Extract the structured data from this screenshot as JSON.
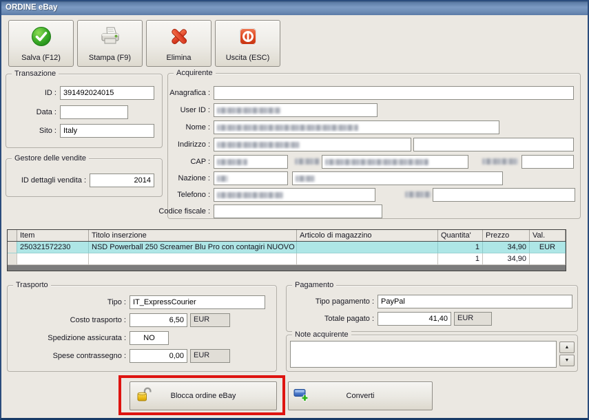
{
  "window": {
    "title": "ORDINE eBay",
    "close_glyph": "✕"
  },
  "toolbar": {
    "salva": "Salva (F12)",
    "stampa": "Stampa (F9)",
    "elimina": "Elimina",
    "uscita": "Uscita (ESC)"
  },
  "transazione": {
    "title": "Transazione",
    "id_label": "ID :",
    "id_value": "391492024015",
    "data_label": "Data :",
    "data_value": "",
    "sito_label": "Sito :",
    "sito_value": "Italy"
  },
  "gestore": {
    "title": "Gestore delle vendite",
    "id_dettagli_label": "ID dettagli vendita :",
    "id_dettagli_value": "2014"
  },
  "acquirente": {
    "title": "Acquirente",
    "anagrafica_label": "Anagrafica :",
    "anagrafica_value": "",
    "user_id_label": "User ID :",
    "nome_label": "Nome :",
    "indirizzo_label": "Indirizzo :",
    "cap_label": "CAP :",
    "nazione_label": "Nazione :",
    "telefono_label": "Telefono :",
    "codice_fiscale_label": "Codice fiscale :",
    "codice_fiscale_value": ""
  },
  "items_table": {
    "columns": [
      "Item",
      "Titolo inserzione",
      "Articolo di magazzino",
      "Quantita'",
      "Prezzo",
      "Val."
    ],
    "rows": [
      {
        "item": "250321572230",
        "titolo": "NSD Powerball 250 Screamer Blu Pro con contagiri NUOVO",
        "articolo": "",
        "quantita": "1",
        "prezzo": "34,90",
        "val": "EUR"
      },
      {
        "item": "",
        "titolo": "",
        "articolo": "",
        "quantita": "1",
        "prezzo": "34,90",
        "val": ""
      }
    ]
  },
  "trasporto": {
    "title": "Trasporto",
    "tipo_label": "Tipo :",
    "tipo_value": "IT_ExpressCourier",
    "costo_label": "Costo trasporto :",
    "costo_value": "6,50",
    "costo_currency": "EUR",
    "spedizione_label": "Spedizione assicurata :",
    "spedizione_value": "NO",
    "spese_label": "Spese contrassegno :",
    "spese_value": "0,00",
    "spese_currency": "EUR"
  },
  "pagamento": {
    "title": "Pagamento",
    "tipo_label": "Tipo pagamento :",
    "tipo_value": "PayPal",
    "totale_label": "Totale pagato :",
    "totale_value": "41,40",
    "totale_currency": "EUR"
  },
  "note": {
    "title": "Note acquirente",
    "value": ""
  },
  "actions": {
    "blocca": "Blocca ordine eBay",
    "converti": "Converti"
  },
  "colors": {
    "titlebar_blue": "#6d8cb5",
    "selected_row": "#aee6e6",
    "annotation_red": "#de1410",
    "window_bg": "#ebe8e2"
  }
}
